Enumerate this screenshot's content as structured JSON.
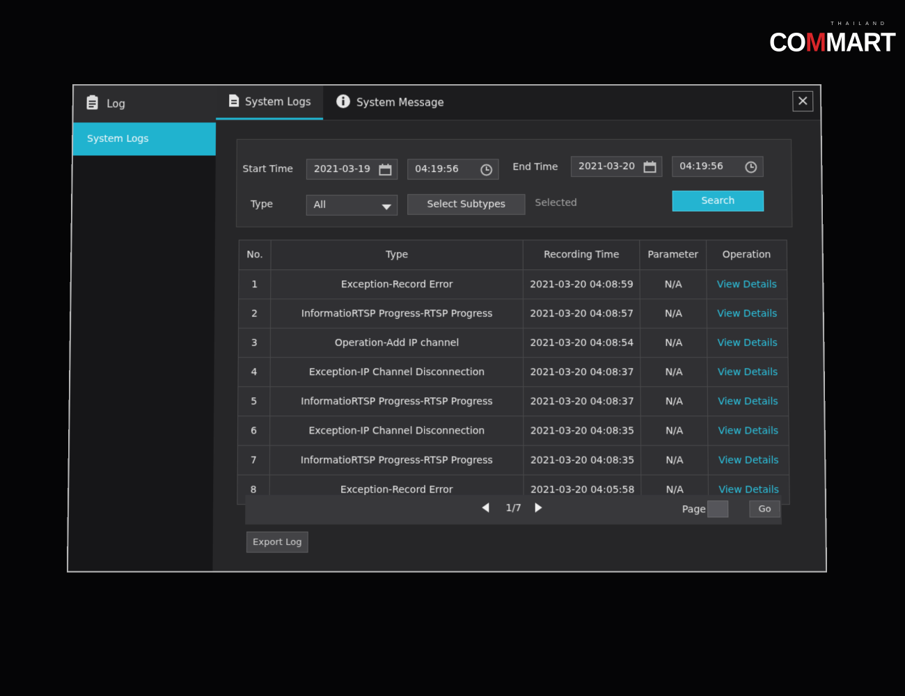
{
  "brand": {
    "tag": "THAILAND",
    "name_start": "CO",
    "name_accent": "M",
    "name_end": "MART"
  },
  "sidebar": {
    "title": "Log",
    "title_icon": "document-icon",
    "items": [
      {
        "label": "System Logs",
        "selected": true
      }
    ]
  },
  "tabs": [
    {
      "label": "System Logs",
      "icon": "document-icon",
      "active": true
    },
    {
      "label": "System Message",
      "icon": "info-icon",
      "active": false
    }
  ],
  "close_label": "×",
  "filter": {
    "start_label": "Start Time",
    "start_date": "2021-03-19",
    "start_time": "04:19:56",
    "end_label": "End Time",
    "end_date": "2021-03-20",
    "end_time": "04:19:56",
    "type_label": "Type",
    "type_value": "All",
    "subtypes_button": "Select Subtypes",
    "selected_label": "Selected",
    "search_button": "Search"
  },
  "table": {
    "headers": [
      "No.",
      "Type",
      "Recording Time",
      "Parameter",
      "Operation"
    ],
    "rows": [
      {
        "no": "1",
        "type": "Exception-Record Error",
        "time": "2021-03-20 04:08:59",
        "param": "N/A",
        "op": "View Details"
      },
      {
        "no": "2",
        "type": "InformatioRTSP Progress-RTSP Progress",
        "time": "2021-03-20 04:08:57",
        "param": "N/A",
        "op": "View Details"
      },
      {
        "no": "3",
        "type": "Operation-Add IP channel",
        "time": "2021-03-20 04:08:54",
        "param": "N/A",
        "op": "View Details"
      },
      {
        "no": "4",
        "type": "Exception-IP Channel Disconnection",
        "time": "2021-03-20 04:08:37",
        "param": "N/A",
        "op": "View Details"
      },
      {
        "no": "5",
        "type": "InformatioRTSP Progress-RTSP Progress",
        "time": "2021-03-20 04:08:37",
        "param": "N/A",
        "op": "View Details"
      },
      {
        "no": "6",
        "type": "Exception-IP Channel Disconnection",
        "time": "2021-03-20 04:08:35",
        "param": "N/A",
        "op": "View Details"
      },
      {
        "no": "7",
        "type": "InformatioRTSP Progress-RTSP Progress",
        "time": "2021-03-20 04:08:35",
        "param": "N/A",
        "op": "View Details"
      },
      {
        "no": "8",
        "type": "Exception-Record Error",
        "time": "2021-03-20 04:05:58",
        "param": "N/A",
        "op": "View Details"
      }
    ]
  },
  "pager": {
    "count": "1/7",
    "page_label": "Page",
    "page_value": "",
    "go_label": "Go"
  },
  "export_button": "Export Log",
  "colors": {
    "accent": "#20b3cf",
    "link": "#2cc5e2",
    "brand_red": "#d9262a"
  }
}
